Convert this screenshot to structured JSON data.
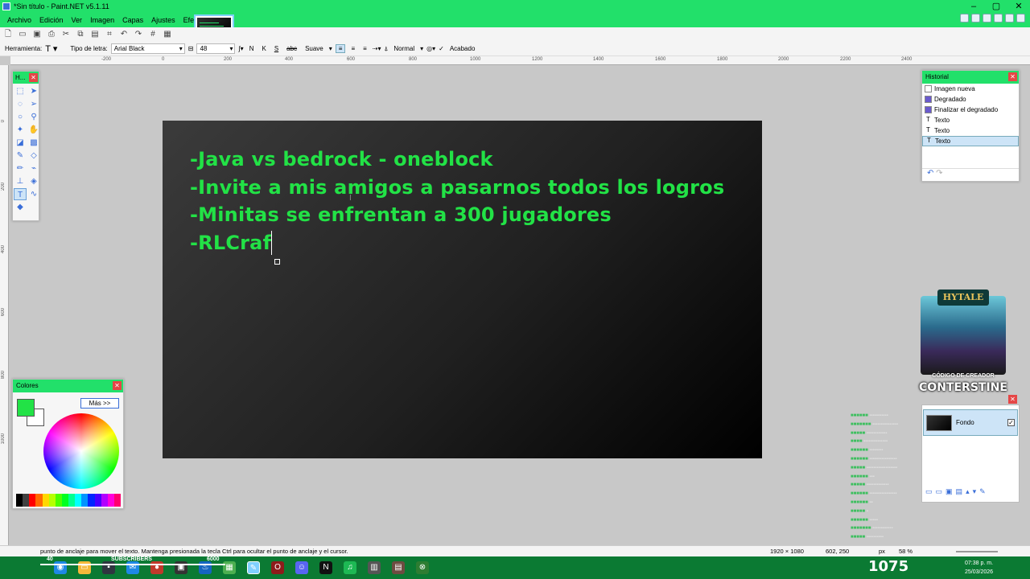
{
  "window": {
    "title": "*Sin título - Paint.NET v5.1.11"
  },
  "menu": [
    "Archivo",
    "Edición",
    "Ver",
    "Imagen",
    "Capas",
    "Ajustes",
    "Efectos"
  ],
  "toolbar2": {
    "tool_label": "Herramienta:",
    "font_type_label": "Tipo de letra:",
    "font_value": "Arial Black",
    "size_value": "48",
    "bold": "N",
    "italic": "K",
    "underline": "S",
    "strike": "abc",
    "smoothing": "Suave",
    "blend_mode": "Normal",
    "finish": "Acabado"
  },
  "ruler_h": [
    "-200",
    "0",
    "200",
    "400",
    "600",
    "800",
    "1000",
    "1200",
    "1400",
    "1600",
    "1800",
    "2000",
    "2200",
    "2400"
  ],
  "ruler_v": [
    "0",
    "200",
    "400",
    "600",
    "800",
    "1000"
  ],
  "canvas_text": [
    "-Java vs bedrock - oneblock",
    "-Invite a mis amigos a pasarnos todos los logros",
    "-Minitas se enfrentan a 300 jugadores",
    "-RLCraf"
  ],
  "tools": {
    "title": "H..."
  },
  "colors_panel": {
    "title": "Colores",
    "more_button": "Más >>",
    "primary": "#22e246",
    "secondary": "#ffffff"
  },
  "history": {
    "title": "Historial",
    "items": [
      "Imagen nueva",
      "Degradado",
      "Finalizar el degradado",
      "Texto",
      "Texto",
      "Texto"
    ]
  },
  "overlay": {
    "logo": "HYTALE",
    "code_label": "CÓDIGO DE CREADOR",
    "creator": "CONTERSTINE"
  },
  "layers": {
    "name": "Fondo"
  },
  "status": {
    "hint": "punto de anclaje para mover el texto. Mantenga presionada la tecla Ctrl para ocultar el punto de anclaje y el cursor.",
    "image_size": "1920 × 1080",
    "cursor_pos": "602, 250",
    "unit": "px",
    "zoom": "58 %"
  },
  "taskbar": {
    "subs_label": "SUBSCRIBERS",
    "subs_current": "40",
    "subs_goal": "6000",
    "viewer_count": "1075",
    "time": "07:38 p. m.",
    "date": "25/03/2026"
  },
  "accent": "#22e06a",
  "text_color": "#22e246"
}
